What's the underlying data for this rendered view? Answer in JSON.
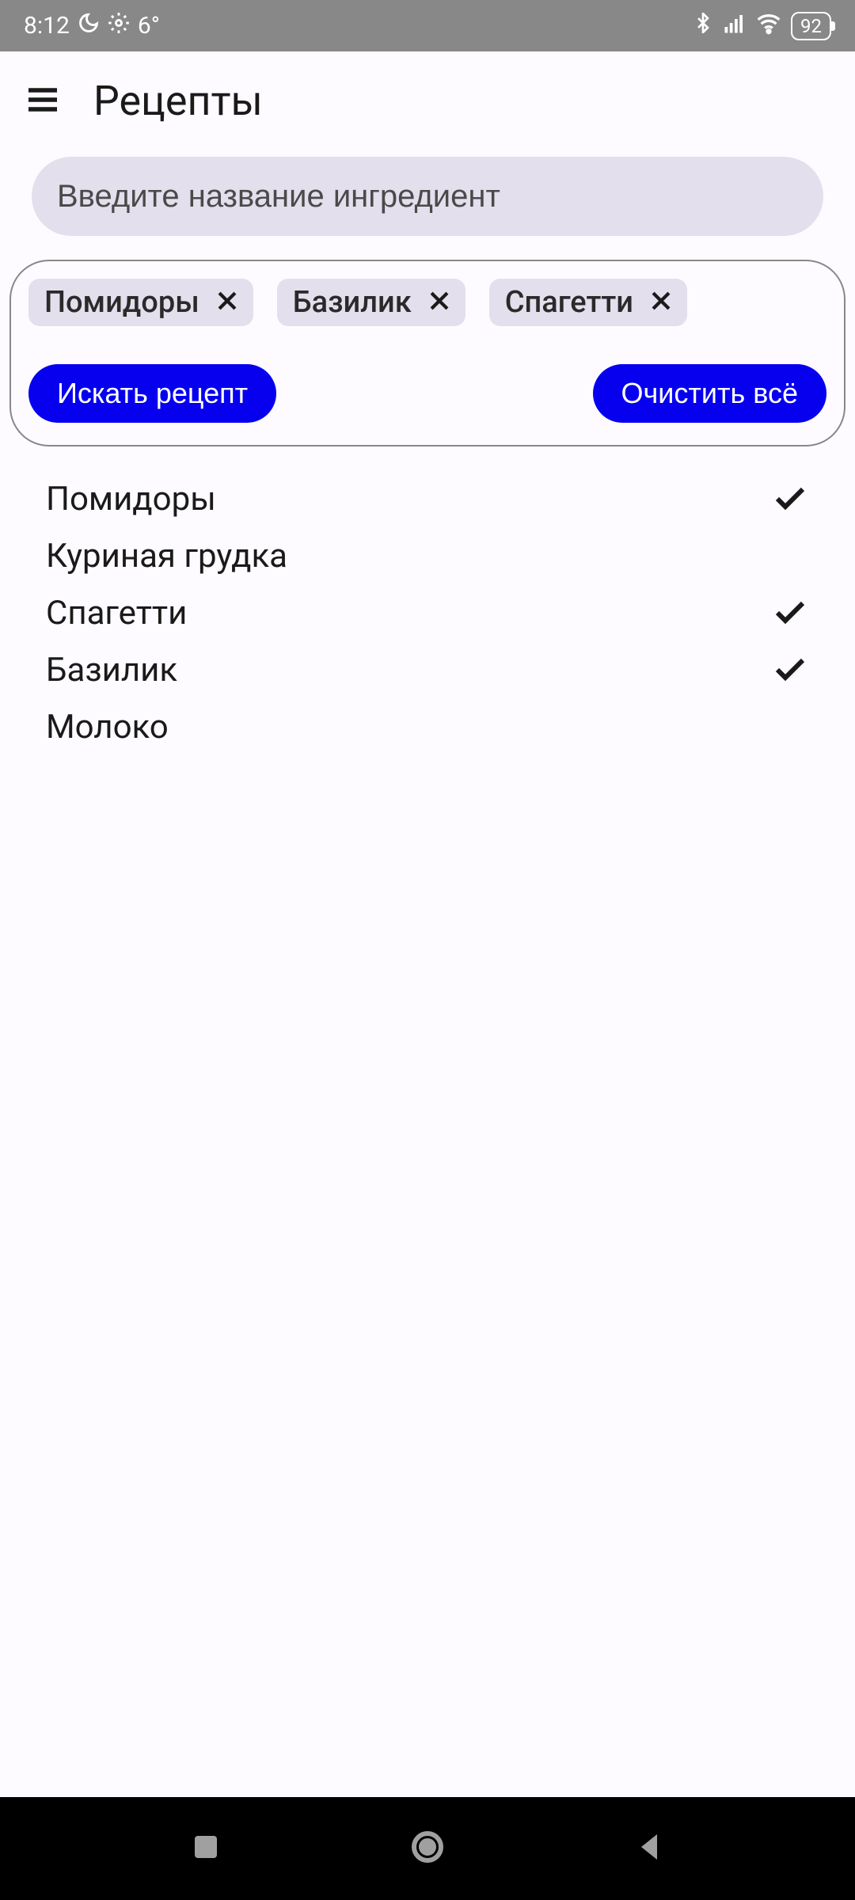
{
  "status_bar": {
    "time": "8:12",
    "temp": "6°",
    "battery": "92"
  },
  "header": {
    "title": "Рецепты"
  },
  "search": {
    "placeholder": "Введите название ингредиент"
  },
  "chips": [
    {
      "label": "Помидоры"
    },
    {
      "label": "Базилик"
    },
    {
      "label": "Спагетти"
    }
  ],
  "buttons": {
    "search": "Искать рецепт",
    "clear": "Очистить всё"
  },
  "ingredients": [
    {
      "name": "Помидоры",
      "selected": true
    },
    {
      "name": "Куриная грудка",
      "selected": false
    },
    {
      "name": "Спагетти",
      "selected": true
    },
    {
      "name": "Базилик",
      "selected": true
    },
    {
      "name": "Молоко",
      "selected": false
    }
  ]
}
